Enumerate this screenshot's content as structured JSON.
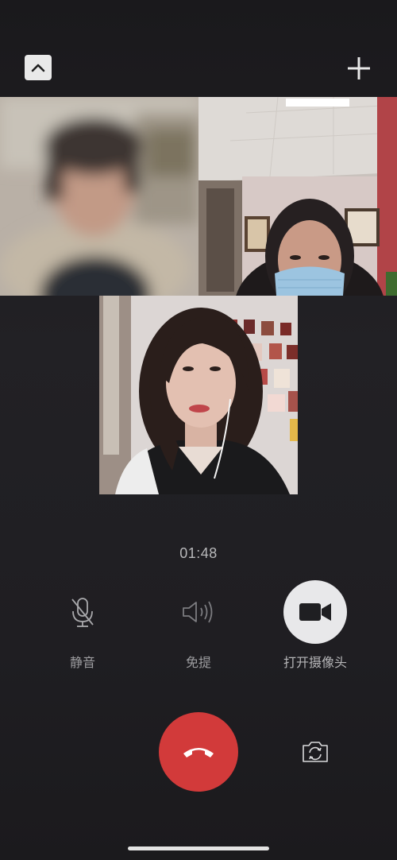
{
  "header": {
    "collapse_icon": "chevron-up-icon",
    "add_icon": "plus-icon"
  },
  "participants": [
    {
      "video": "blurred-participant-video"
    },
    {
      "video": "participant-with-mask-video"
    },
    {
      "video": "participant-selfview-video"
    }
  ],
  "call": {
    "duration": "01:48"
  },
  "controls": {
    "mute_label": "静音",
    "speaker_label": "免提",
    "camera_label": "打开摄像头"
  },
  "actions": {
    "hangup_icon": "phone-hangup-icon",
    "flip_icon": "camera-switch-icon"
  },
  "colors": {
    "hangup": "#d23a3a",
    "background": "#1d1c1f"
  }
}
